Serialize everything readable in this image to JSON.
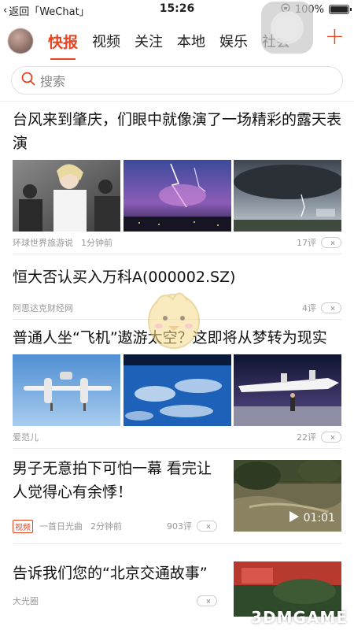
{
  "status": {
    "back_label": "返回「WeChat」",
    "time": "15:26",
    "battery": "100%"
  },
  "channels": {
    "tabs": [
      "快报",
      "视频",
      "关注",
      "本地",
      "娱乐",
      "社会"
    ],
    "active": "快报",
    "add_label": "+"
  },
  "search": {
    "placeholder": "搜索"
  },
  "feed": [
    {
      "headline": "台风来到肇庆，们眼中就像演了一场精彩的露天表演",
      "source": "环球世界旅游说",
      "time": "1分钟前",
      "comments": "17评"
    },
    {
      "headline": "恒大否认买入万科A(000002.SZ)",
      "source": "阿思达克财经网",
      "comments": "4评"
    },
    {
      "headline": "普通人坐“飞机”遨游太空？这即将从梦转为现实",
      "source": "爱范儿",
      "comments": "22评"
    },
    {
      "headline": "男子无意拍下可怕一幕 看完让人觉得心有余悸！",
      "tag": "视频",
      "source": "一首日光曲",
      "time": "2分钟前",
      "comments": "903评",
      "duration": "01:01"
    },
    {
      "headline": "告诉我们您的“北京交通故事”",
      "source": "大光圈"
    }
  ],
  "watermark": "3DMGAME",
  "colors": {
    "accent": "#e8441f"
  }
}
